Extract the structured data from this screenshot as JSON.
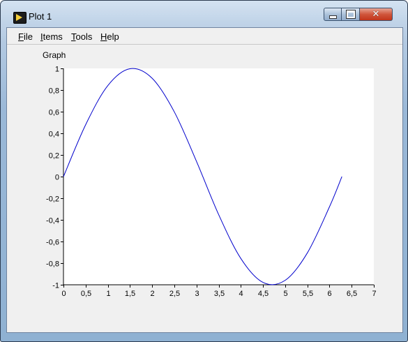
{
  "window": {
    "title": "Plot 1"
  },
  "menu": [
    {
      "label": "File",
      "accel": "F",
      "rest": "ile"
    },
    {
      "label": "Items",
      "accel": "I",
      "rest": "tems"
    },
    {
      "label": "Tools",
      "accel": "T",
      "rest": "ools"
    },
    {
      "label": "Help",
      "accel": "H",
      "rest": "elp"
    }
  ],
  "graph": {
    "label": "Graph",
    "line_color": "#0000cc"
  },
  "chart_data": {
    "type": "line",
    "title": "",
    "xlabel": "",
    "ylabel": "",
    "xlim": [
      0,
      7
    ],
    "ylim": [
      -1,
      1
    ],
    "x_ticks": [
      "0",
      "0,5",
      "1",
      "1,5",
      "2",
      "2,5",
      "3",
      "3,5",
      "4",
      "4,5",
      "5",
      "5,5",
      "6",
      "6,5",
      "7"
    ],
    "y_ticks": [
      "1",
      "0,8",
      "0,6",
      "0,4",
      "0,2",
      "0",
      "-0,2",
      "-0,4",
      "-0,6",
      "-0,8",
      "-1"
    ],
    "grid": false,
    "series": [
      {
        "x": [
          0,
          0.5,
          1,
          1.5,
          2,
          2.5,
          3,
          3.5,
          4,
          4.5,
          5,
          5.5,
          6,
          6.28
        ],
        "y": [
          0,
          0.479,
          0.841,
          0.997,
          0.909,
          0.598,
          0.141,
          -0.351,
          -0.757,
          -0.978,
          -0.959,
          -0.706,
          -0.279,
          0
        ]
      }
    ]
  }
}
